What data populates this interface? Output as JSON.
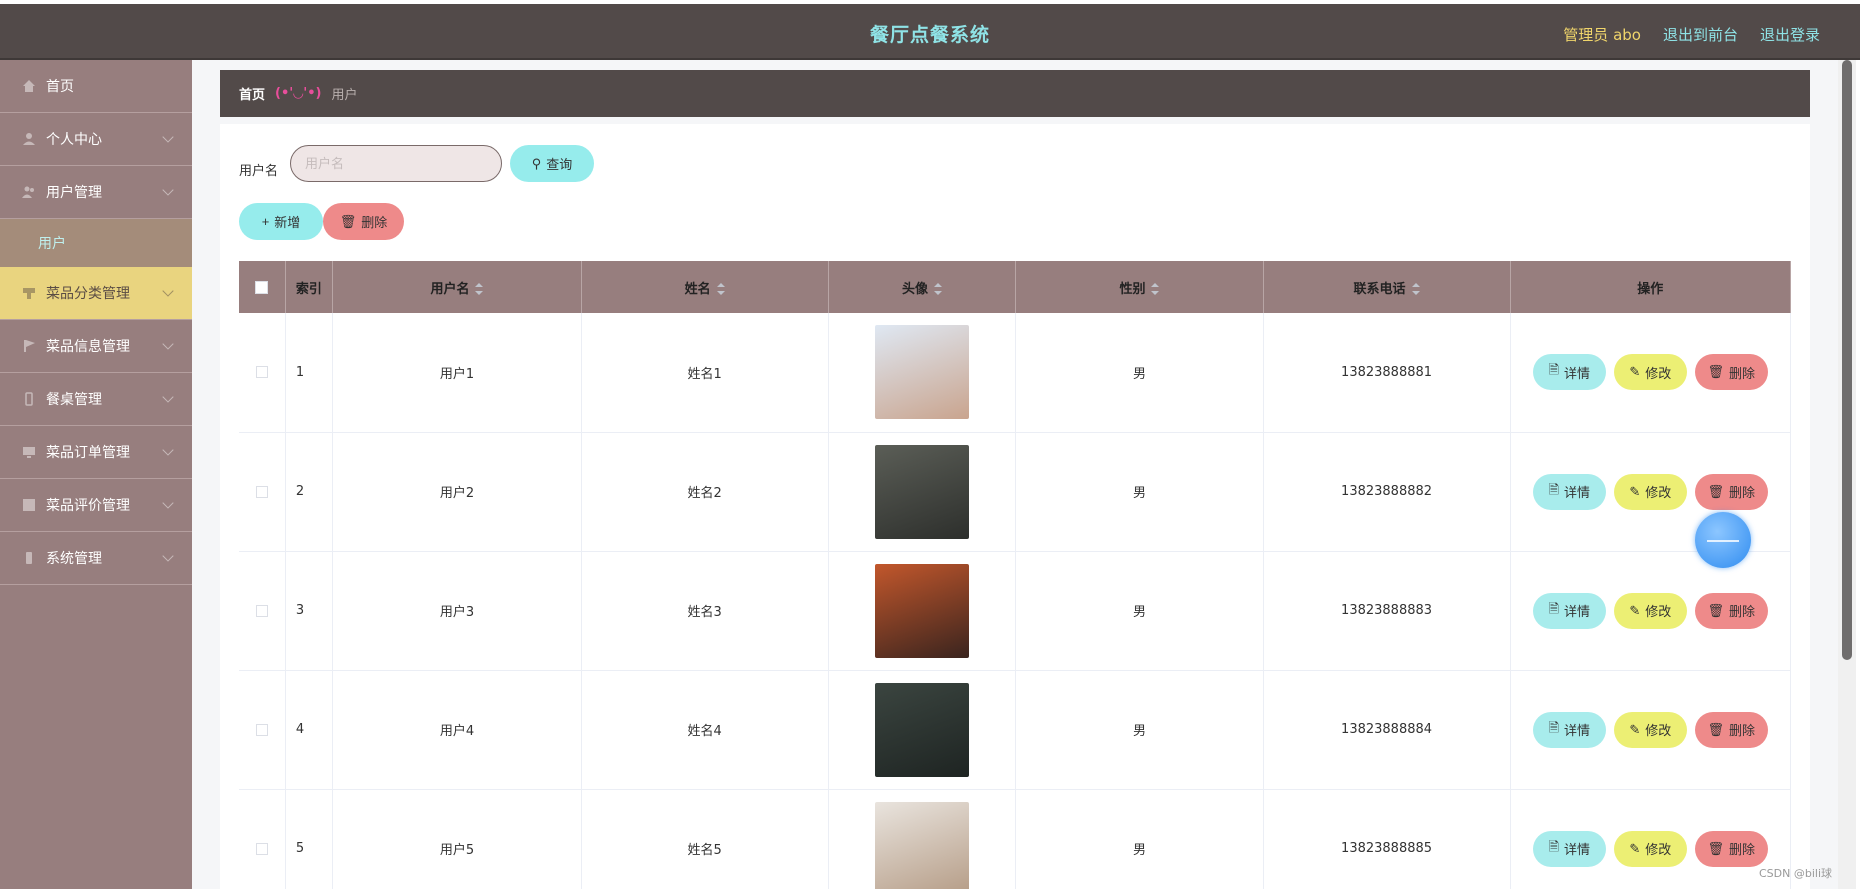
{
  "app": {
    "title": "餐厅点餐系统",
    "admin_label": "管理员 abo",
    "to_front": "退出到前台",
    "logout": "退出登录"
  },
  "sidebar": {
    "items": [
      {
        "label": "首页"
      },
      {
        "label": "个人中心"
      },
      {
        "label": "用户管理"
      },
      {
        "label": "菜品分类管理"
      },
      {
        "label": "菜品信息管理"
      },
      {
        "label": "餐桌管理"
      },
      {
        "label": "菜品订单管理"
      },
      {
        "label": "菜品评价管理"
      },
      {
        "label": "系统管理"
      }
    ],
    "sub_active": "用户"
  },
  "breadcrumb": {
    "home": "首页",
    "sep": "(•'◡'•)",
    "current": "用户"
  },
  "search": {
    "label": "用户名",
    "placeholder": "用户名",
    "query_btn": "查询"
  },
  "actions": {
    "add": "新增",
    "delete": "删除"
  },
  "table": {
    "columns": [
      "索引",
      "用户名",
      "姓名",
      "头像",
      "性别",
      "联系电话",
      "操作"
    ],
    "rows": [
      {
        "index": "1",
        "username": "用户1",
        "name": "姓名1",
        "gender": "男",
        "phone": "13823888881"
      },
      {
        "index": "2",
        "username": "用户2",
        "name": "姓名2",
        "gender": "男",
        "phone": "13823888882"
      },
      {
        "index": "3",
        "username": "用户3",
        "name": "姓名3",
        "gender": "男",
        "phone": "13823888883"
      },
      {
        "index": "4",
        "username": "用户4",
        "name": "姓名4",
        "gender": "男",
        "phone": "13823888884"
      },
      {
        "index": "5",
        "username": "用户5",
        "name": "姓名5",
        "gender": "男",
        "phone": "13823888885"
      }
    ],
    "row_actions": {
      "detail": "详情",
      "edit": "修改",
      "delete": "删除"
    }
  },
  "watermark": "CSDN @bili球",
  "colors": {
    "topbar": "#524a49",
    "sidebar": "#977e7e",
    "accent_cyan": "#96ecec",
    "accent_yellow": "#ecef74",
    "accent_red": "#ee8a8a"
  }
}
